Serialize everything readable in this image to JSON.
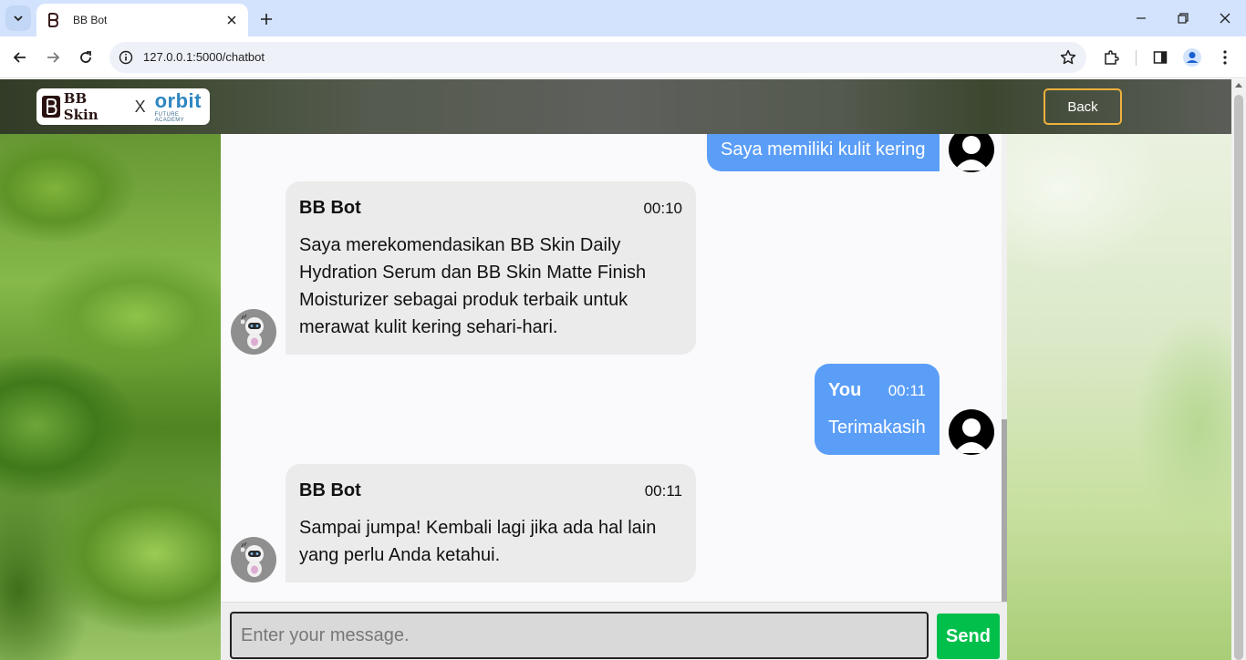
{
  "browser": {
    "tab_title": "BB Bot",
    "url": "127.0.0.1:5000/chatbot"
  },
  "navbar": {
    "logo_bb": "BB Skin",
    "logo_x": "X",
    "logo_orbit": "orbit",
    "logo_orbit_sub": "FUTURE ACADEMY",
    "back_label": "Back"
  },
  "chat": {
    "messages": [
      {
        "sender": "",
        "time": "",
        "text": "Saya memiliki kulit kering",
        "role": "user"
      },
      {
        "sender": "BB Bot",
        "time": "00:10",
        "text": "Saya merekomendasikan BB Skin Daily Hydration Serum dan BB Skin Matte Finish Moisturizer sebagai produk terbaik untuk merawat kulit kering sehari-hari.",
        "role": "bot"
      },
      {
        "sender": "You",
        "time": "00:11",
        "text": "Terimakasih",
        "role": "user"
      },
      {
        "sender": "BB Bot",
        "time": "00:11",
        "text": "Sampai jumpa! Kembali lagi jika ada hal lain yang perlu Anda ketahui.",
        "role": "bot"
      }
    ],
    "input_placeholder": "Enter your message.",
    "send_label": "Send"
  },
  "colors": {
    "user_bubble": "#5b9ef8",
    "bot_bubble": "#ebebeb",
    "send_button": "#00c04b",
    "back_border": "#f0b13d"
  }
}
